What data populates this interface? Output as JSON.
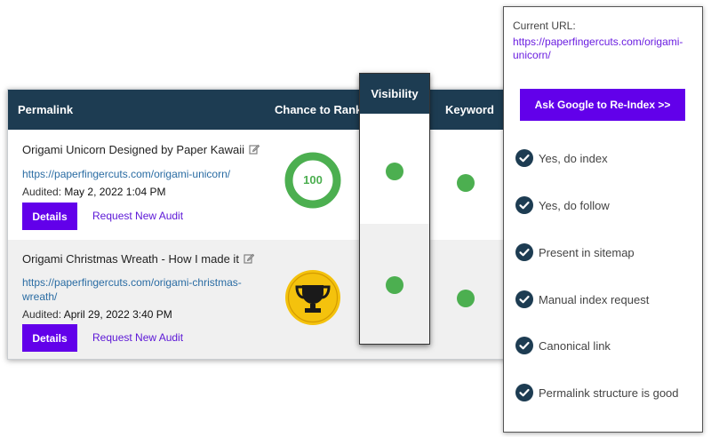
{
  "colors": {
    "header_bg": "#1d3c52",
    "accent_purple": "#6200ea",
    "status_green": "#4caf50",
    "trophy_gold": "#f4c20d",
    "link_blue": "#2a6ca3"
  },
  "table": {
    "headers": {
      "permalink": "Permalink",
      "chance_to_rank": "Chance to Rank",
      "visibility": "Visibility",
      "keyword": "Keyword"
    },
    "rows": [
      {
        "title": "Origami Unicorn Designed by Paper Kawaii",
        "url": "https://paperfingercuts.com/origami-unicorn/",
        "audited_label": "Audited:",
        "audited_date": "May 2, 2022 1:04 PM",
        "details_label": "Details",
        "request_audit_label": "Request New Audit",
        "chance_score": "100",
        "chance_icon": "score-ring-icon",
        "visibility_status": "green",
        "keyword_status": "green"
      },
      {
        "title": "Origami Christmas Wreath - How I made it",
        "url": "https://paperfingercuts.com/origami-christmas-wreath/",
        "audited_label": "Audited:",
        "audited_date": "April 29, 2022 3:40 PM",
        "details_label": "Details",
        "request_audit_label": "Request New Audit",
        "chance_icon": "trophy-icon",
        "visibility_status": "green",
        "keyword_status": "green"
      }
    ]
  },
  "side_panel": {
    "current_url_label": "Current URL:",
    "current_url": "https://paperfingercuts.com/origami-unicorn/",
    "reindex_button": "Ask Google to Re-Index >>",
    "checks": [
      {
        "label": "Yes, do index",
        "icon": "check-circle-icon"
      },
      {
        "label": "Yes, do follow",
        "icon": "check-circle-icon"
      },
      {
        "label": "Present in sitemap",
        "icon": "check-circle-icon"
      },
      {
        "label": "Manual index request",
        "icon": "check-circle-icon"
      },
      {
        "label": "Canonical link",
        "icon": "check-circle-icon"
      },
      {
        "label": "Permalink structure is good",
        "icon": "check-circle-icon"
      }
    ]
  }
}
